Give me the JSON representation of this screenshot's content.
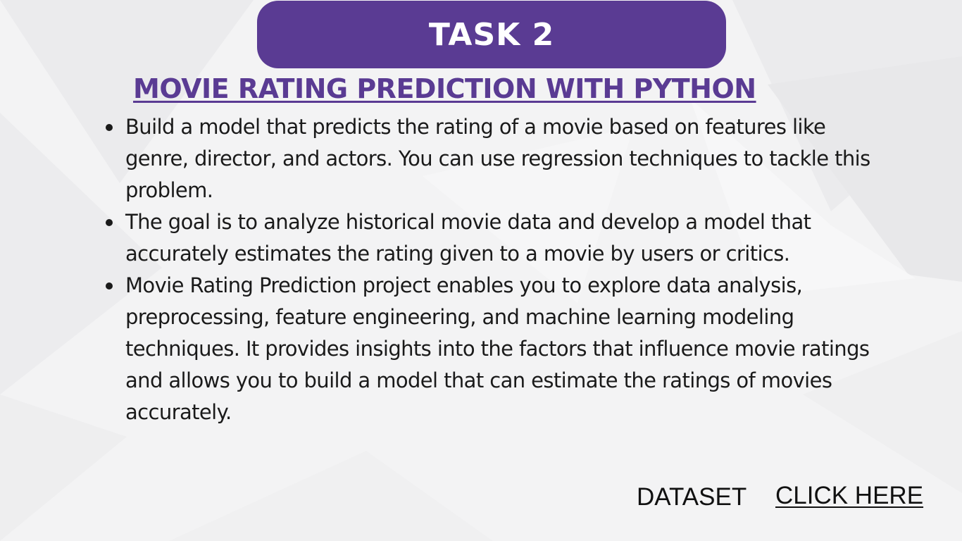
{
  "badge": {
    "label": "TASK 2"
  },
  "title": "MOVIE RATING PREDICTION WITH PYTHON",
  "bullets": [
    "Build a model that predicts the rating of a movie based on features like genre, director, and actors. You can use regression techniques to tackle this problem.",
    "The goal is to analyze historical movie data and develop a model that accurately estimates the rating given to a movie by users or critics.",
    "Movie Rating Prediction project enables you to explore data analysis, preprocessing, feature engineering, and machine learning modeling techniques. It provides insights into the factors that influence movie ratings and allows you to build a model that can estimate the ratings of movies accurately."
  ],
  "footer": {
    "dataset_label": "DATASET",
    "link_label": "CLICK HERE"
  },
  "colors": {
    "accent": "#5a3b93",
    "background": "#f3f3f4",
    "text": "#1a1a1a"
  }
}
